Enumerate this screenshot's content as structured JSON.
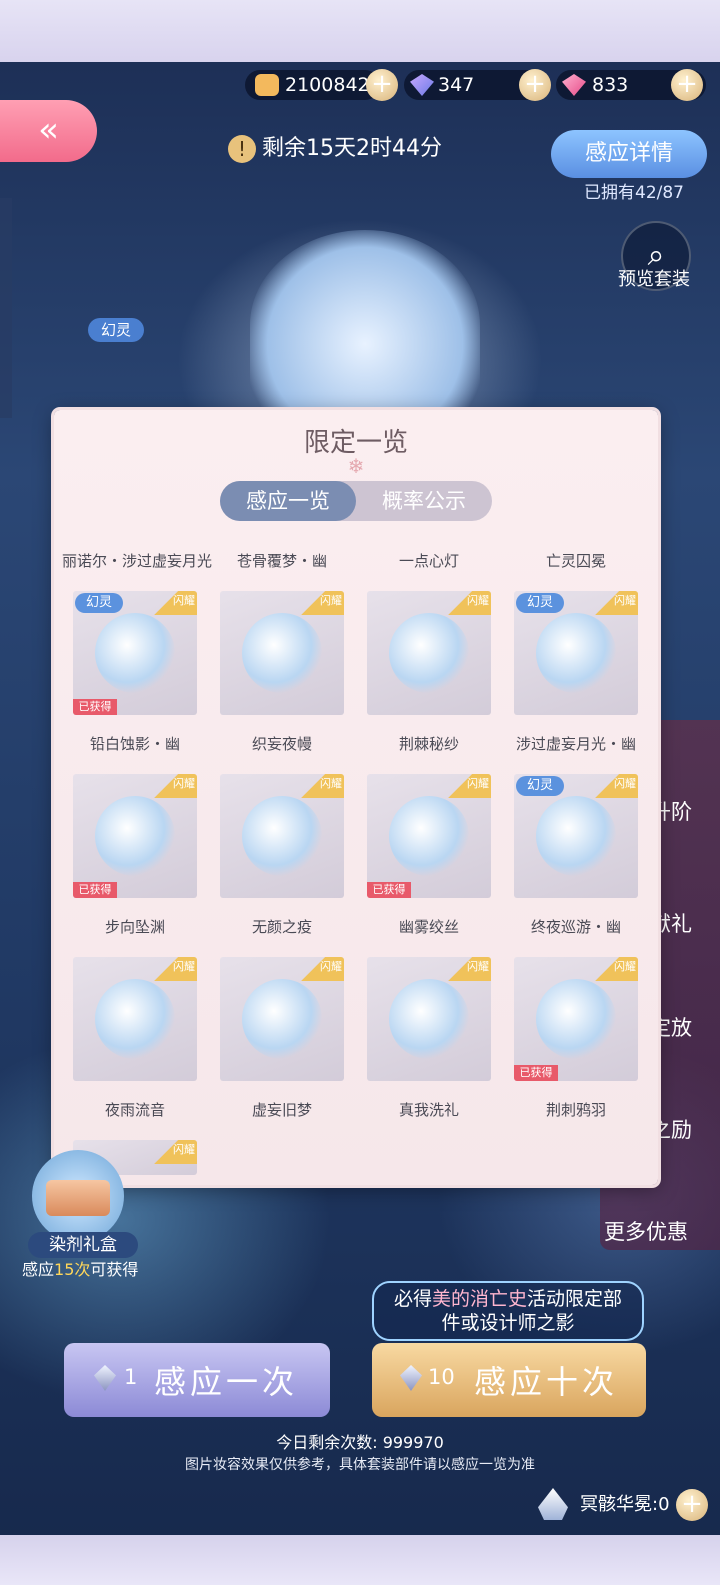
{
  "currency": {
    "coins": "2100842",
    "diamonds": "347",
    "crystals": "833",
    "plus_label": "+"
  },
  "header": {
    "timer": "剩余15天2时44分",
    "timer_icon": "!",
    "back_label": "«",
    "detail_button": "感应详情",
    "owned": "已拥有42/87",
    "preview_label": "预览套装",
    "left_badge": "幻灵"
  },
  "modal": {
    "title": "限定一览",
    "flake": "❄",
    "tabs": [
      "感应一览",
      "概率公示"
    ],
    "partial_row": [
      "丽诺尔・涉过虚妄月光",
      "苍骨覆梦・幽",
      "一点心灯",
      "亡灵囚冕"
    ],
    "items": [
      {
        "name": "铅白蚀影・幽",
        "ling": "幻灵",
        "got": "已获得",
        "tag": "闪耀"
      },
      {
        "name": "织妄夜幔",
        "ling": "",
        "got": "",
        "tag": "闪耀"
      },
      {
        "name": "荆棘秘纱",
        "ling": "",
        "got": "",
        "tag": "闪耀"
      },
      {
        "name": "涉过虚妄月光・幽",
        "ling": "幻灵",
        "got": "",
        "tag": "闪耀"
      },
      {
        "name": "步向坠渊",
        "ling": "",
        "got": "已获得",
        "tag": "闪耀"
      },
      {
        "name": "无颜之疫",
        "ling": "",
        "got": "",
        "tag": "闪耀"
      },
      {
        "name": "幽雾绞丝",
        "ling": "",
        "got": "已获得",
        "tag": "闪耀"
      },
      {
        "name": "终夜巡游・幽",
        "ling": "幻灵",
        "got": "",
        "tag": "闪耀"
      },
      {
        "name": "夜雨流音",
        "ling": "",
        "got": "",
        "tag": "闪耀"
      },
      {
        "name": "虚妄旧梦",
        "ling": "",
        "got": "",
        "tag": "闪耀"
      },
      {
        "name": "真我洗礼",
        "ling": "",
        "got": "",
        "tag": "闪耀"
      },
      {
        "name": "荆刺鸦羽",
        "ling": "",
        "got": "已获得",
        "tag": "闪耀"
      }
    ],
    "partial_bottom_tag": "闪耀"
  },
  "side_menu": {
    "items": [
      "升阶",
      "献礼",
      "绽放",
      "奖励",
      "更多优惠"
    ],
    "visible": [
      "升阶",
      "献礼",
      "定放",
      "之励",
      "更多优惠"
    ]
  },
  "gift": {
    "label": "染剂礼盒",
    "note_prefix": "感应",
    "note_count": "15次",
    "note_suffix": "可获得"
  },
  "notice": {
    "line1_a": "必得",
    "line1_b": "美的消亡史",
    "line1_c": "活动限定部",
    "line2": "件或设计师之影"
  },
  "actions": {
    "one_count": "1",
    "one_label": "感应一次",
    "ten_count": "10",
    "ten_label": "感应十次"
  },
  "footer": {
    "remaining": "今日剩余次数: 999970",
    "disclaimer": "图片妆容效果仅供参考，具体套装部件请以感应一览为准",
    "skull_label": "冥骸华冕:0"
  },
  "colors": {
    "accent_blue": "#5a8fe2",
    "pink": "#f26b8b",
    "gold": "#d9a55e",
    "got_red": "#e85a6a"
  }
}
